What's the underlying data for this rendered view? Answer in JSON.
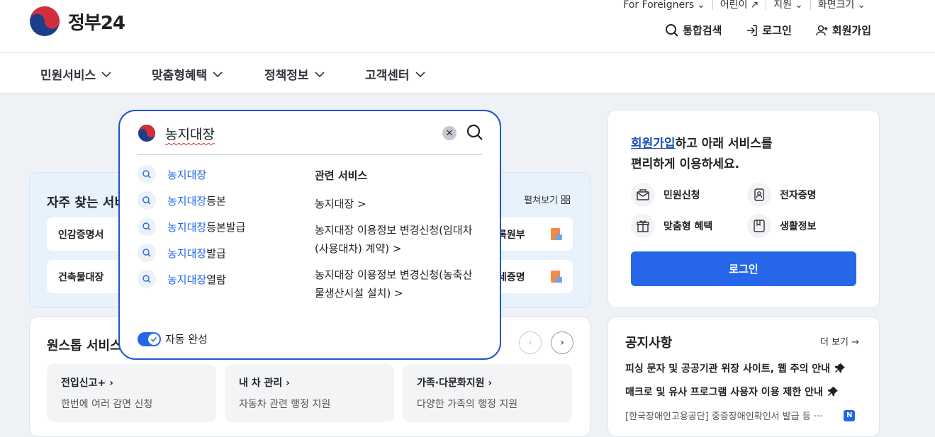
{
  "header": {
    "logo_text": "정부24",
    "util_links": [
      {
        "label": "For Foreigners"
      },
      {
        "label": "어린이"
      },
      {
        "label": "지원"
      },
      {
        "label": "화면크기"
      }
    ],
    "actions": {
      "search": "통합검색",
      "login": "로그인",
      "signup": "회원가입"
    }
  },
  "gnb": {
    "items": [
      {
        "label": "민원서비스"
      },
      {
        "label": "맞춤형혜택"
      },
      {
        "label": "정책정보"
      },
      {
        "label": "고객센터"
      }
    ]
  },
  "favorites": {
    "title": "자주 찾는 서비",
    "expand": "펼쳐보기",
    "items": [
      {
        "label": "인감증명서"
      },
      {
        "label": "건축물대장"
      },
      {
        "label": "록원부"
      },
      {
        "label": "세증명"
      }
    ]
  },
  "onestop": {
    "title": "원스톱 서비스",
    "cards": [
      {
        "title": "전입신고+",
        "desc": "한번에 여러 감면 신청"
      },
      {
        "title": "내 차 관리",
        "desc": "자동차 관련 행정 지원"
      },
      {
        "title": "가족·다문화지원",
        "desc": "다양한 가족의 행정 지원"
      }
    ]
  },
  "member": {
    "link": "회원가입",
    "msg_rest": "하고 아래 서비스를",
    "msg_line2": "편리하게 이용하세요.",
    "services": [
      {
        "label": "민원신청"
      },
      {
        "label": "전자증명"
      },
      {
        "label": "맞춤형 혜택"
      },
      {
        "label": "생활정보"
      }
    ],
    "login_button": "로그인"
  },
  "notice": {
    "title": "공지사항",
    "more": "더 보기 →",
    "items": [
      {
        "text": "피싱 문자 및 공공기관 위장 사이트, 웹 주의 안내"
      },
      {
        "text": "매크로 및 유사 프로그램 사용자 이용 제한 안내"
      },
      {
        "text": "[한국장애인고용공단] 중증장애인확인서 발급 등 ···",
        "badge": "N"
      }
    ]
  },
  "search_popup": {
    "query": "농지대장",
    "suggestions": [
      {
        "hl": "농지대장",
        "rest": ""
      },
      {
        "hl": "농지대장",
        "rest": "등본"
      },
      {
        "hl": "농지대장",
        "rest": "등본발급"
      },
      {
        "hl": "농지대장",
        "rest": "발급"
      },
      {
        "hl": "농지대장",
        "rest": "열람"
      }
    ],
    "related_title": "관련 서비스",
    "related": [
      {
        "line1": "농지대장 >",
        "line2": ""
      },
      {
        "line1": "농지대장 이용정보 변경신청(임대차",
        "line2": "(사용대차) 계약) >"
      },
      {
        "line1": "농지대장 이용정보 변경신청(농축산",
        "line2": "물생산시설 설치) >"
      }
    ],
    "autocomplete_label": "자동 완성",
    "autocomplete_on": true
  },
  "colors": {
    "accent": "#2567e8",
    "popup_border": "#1f55c7",
    "fav_bg": "#e8f2fd",
    "page_bg": "#eef1f6"
  }
}
